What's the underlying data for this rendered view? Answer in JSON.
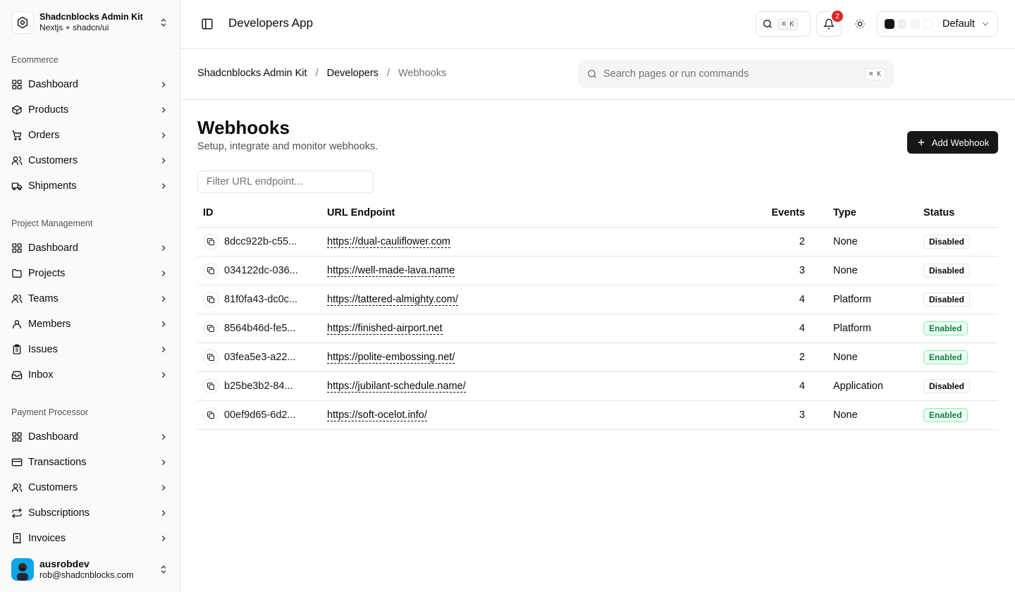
{
  "brand": {
    "name": "Shadcnblocks Admin Kit",
    "subtitle": "Nextjs + shadcn/ui"
  },
  "sidebar": {
    "groups": [
      {
        "label": "Ecommerce",
        "items": [
          {
            "label": "Dashboard",
            "icon": "layout-grid-icon"
          },
          {
            "label": "Products",
            "icon": "package-icon"
          },
          {
            "label": "Orders",
            "icon": "shopping-cart-icon"
          },
          {
            "label": "Customers",
            "icon": "users-icon"
          },
          {
            "label": "Shipments",
            "icon": "truck-icon"
          }
        ]
      },
      {
        "label": "Project Management",
        "items": [
          {
            "label": "Dashboard",
            "icon": "layout-grid-icon"
          },
          {
            "label": "Projects",
            "icon": "folder-icon"
          },
          {
            "label": "Teams",
            "icon": "users-icon"
          },
          {
            "label": "Members",
            "icon": "user-icon"
          },
          {
            "label": "Issues",
            "icon": "clipboard-icon"
          },
          {
            "label": "Inbox",
            "icon": "inbox-icon"
          }
        ]
      },
      {
        "label": "Payment Processor",
        "items": [
          {
            "label": "Dashboard",
            "icon": "layout-grid-icon"
          },
          {
            "label": "Transactions",
            "icon": "credit-card-icon"
          },
          {
            "label": "Customers",
            "icon": "users-icon"
          },
          {
            "label": "Subscriptions",
            "icon": "repeat-icon"
          },
          {
            "label": "Invoices",
            "icon": "receipt-icon"
          }
        ]
      }
    ]
  },
  "user": {
    "name": "ausrobdev",
    "email": "rob@shadcnblocks.com"
  },
  "topbar": {
    "title": "Developers App",
    "search_shortcut": "⌘ K",
    "notification_count": "2",
    "theme_label": "Default"
  },
  "breadcrumb": {
    "root": "Shadcnblocks Admin Kit",
    "parent": "Developers",
    "current": "Webhooks",
    "separator": "/"
  },
  "command_search": {
    "placeholder": "Search pages or run commands",
    "shortcut": "⌘ K"
  },
  "page": {
    "title": "Webhooks",
    "subtitle": "Setup, integrate and monitor webhooks.",
    "add_button": "Add Webhook",
    "filter_placeholder": "Filter URL endpoint..."
  },
  "table": {
    "headers": {
      "id": "ID",
      "url": "URL Endpoint",
      "events": "Events",
      "type": "Type",
      "status": "Status"
    },
    "rows": [
      {
        "id": "8dcc922b-c55...",
        "url": "https://dual-cauliflower.com",
        "events": "2",
        "type": "None",
        "status": "Disabled"
      },
      {
        "id": "034122dc-036...",
        "url": "https://well-made-lava.name",
        "events": "3",
        "type": "None",
        "status": "Disabled"
      },
      {
        "id": "81f0fa43-dc0c...",
        "url": "https://tattered-almighty.com/",
        "events": "4",
        "type": "Platform",
        "status": "Disabled"
      },
      {
        "id": "8564b46d-fe5...",
        "url": "https://finished-airport.net",
        "events": "4",
        "type": "Platform",
        "status": "Enabled"
      },
      {
        "id": "03fea5e3-a22...",
        "url": "https://polite-embossing.net/",
        "events": "2",
        "type": "None",
        "status": "Enabled"
      },
      {
        "id": "b25be3b2-84...",
        "url": "https://jubilant-schedule.name/",
        "events": "4",
        "type": "Application",
        "status": "Disabled"
      },
      {
        "id": "00ef9d65-6d2...",
        "url": "https://soft-ocelot.info/",
        "events": "3",
        "type": "None",
        "status": "Enabled"
      }
    ]
  },
  "colors": {
    "primary": "#171717",
    "border": "#e5e5e5",
    "enabled": "#15803d",
    "badge": "#dc2626"
  }
}
